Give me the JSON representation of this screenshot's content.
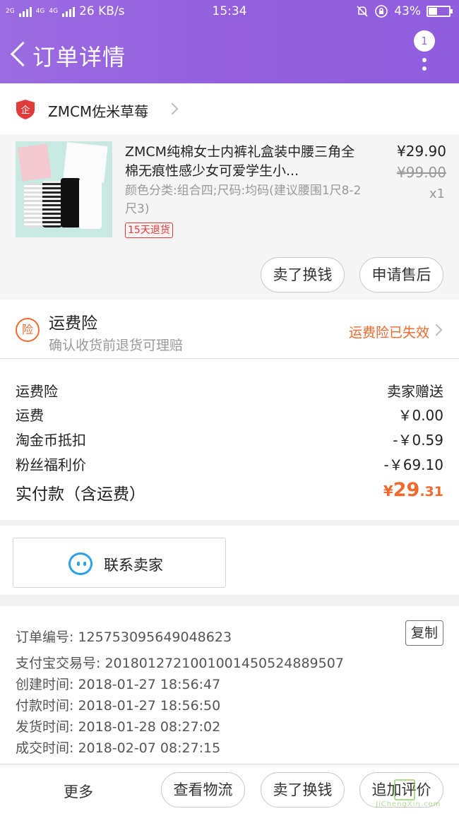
{
  "status_bar": {
    "network_1": "2G",
    "network_2": "4G",
    "network_3": "4G",
    "speed": "26 KB/s",
    "time": "15:34",
    "battery": "43%",
    "battery_level": 0.43
  },
  "header": {
    "title": "订单详情",
    "badge_count": "1"
  },
  "store": {
    "name": "ZMCM佐米草莓",
    "icon_glyph": "企"
  },
  "product": {
    "title": "ZMCM纯棉女士内裤礼盒装中腰三角全棉无痕性感少女可爱学生小...",
    "sku": "颜色分类:组合四;尺码:均码(建议腰围1尺8-2尺3)",
    "refund_tag": "15天退货",
    "price": "¥29.90",
    "original_price": "¥99.00",
    "quantity": "x1",
    "actions": [
      "卖了换钱",
      "申请售后"
    ]
  },
  "insurance": {
    "icon_glyph": "险",
    "title": "运费险",
    "subtitle": "确认收货前退货可理赔",
    "status": "运费险已失效"
  },
  "costs": {
    "rows": [
      {
        "label": "运费险",
        "value": "卖家赠送"
      },
      {
        "label": "运费",
        "value": "￥0.00"
      },
      {
        "label": "淘金币抵扣",
        "value": "-￥0.59"
      },
      {
        "label": "粉丝福利价",
        "value": "-￥69.10"
      }
    ],
    "paid_label": "实付款（含运费）",
    "paid_symbol": "¥",
    "paid_integer": "29",
    "paid_decimal": ".31"
  },
  "contact": {
    "label": "联系卖家"
  },
  "order_info": {
    "rows": [
      "订单编号: 125753095649048623",
      "支付宝交易号: 2018012721001001450524889507",
      "创建时间: 2018-01-27 18:56:47",
      "付款时间: 2018-01-27 18:56:50",
      "发货时间: 2018-01-28 08:27:02",
      "成交时间: 2018-02-07 08:27:15"
    ],
    "copy_label": "复制"
  },
  "bottom_bar": {
    "more": "更多",
    "buttons": [
      "查看物流",
      "卖了换钱",
      "追加评价"
    ]
  },
  "watermark": {
    "text": "JiChengXin.com"
  },
  "colors": {
    "header_purple": "#9460df",
    "accent_orange": "#f0692d",
    "refund_red": "#e03b3b",
    "contact_blue": "#2aa0e8"
  }
}
